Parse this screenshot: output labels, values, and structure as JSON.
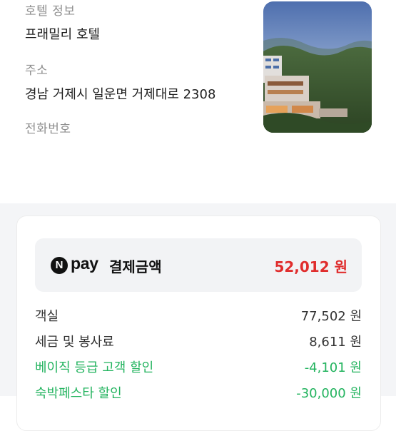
{
  "hotel_info": {
    "section_label": "호텔 정보",
    "name": "프래밀리 호텔",
    "address_label": "주소",
    "address": "경남 거제시 일운면 거제대로 2308",
    "phone_label": "전화번호"
  },
  "photo": {
    "icon": "hotel-photo",
    "sky_color": "#5f7fb8",
    "hill_color": "#3e5b34"
  },
  "payment": {
    "npay_badge": "N",
    "npay_text": "pay",
    "label": "결제금액",
    "amount": "52,012 원",
    "amount_color": "#e02d2d"
  },
  "breakdown": [
    {
      "label": "객실",
      "value": "77,502 원",
      "kind": "normal"
    },
    {
      "label": "세금 및 봉사료",
      "value": "8,611 원",
      "kind": "normal"
    },
    {
      "label": "베이직 등급 고객 할인",
      "value": "-4,101 원",
      "kind": "discount"
    },
    {
      "label": "숙박페스타 할인",
      "value": "-30,000 원",
      "kind": "discount"
    }
  ],
  "colors": {
    "discount": "#22b35e",
    "background_section": "#f4f5f7"
  }
}
